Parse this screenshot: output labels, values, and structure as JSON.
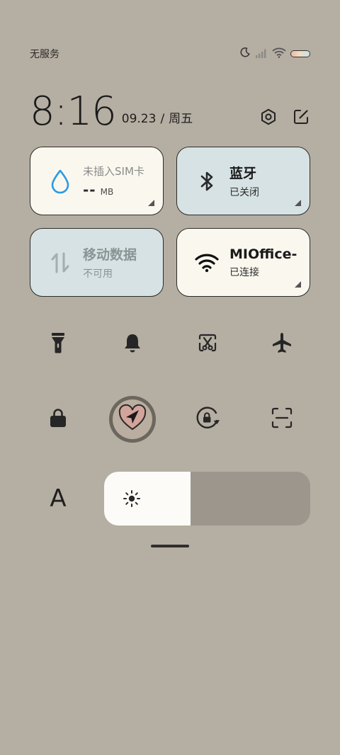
{
  "status": {
    "carrier": "无服务",
    "icons": [
      "moon-icon",
      "signal-icon",
      "wifi-icon",
      "battery-icon"
    ]
  },
  "clock": {
    "time": "8:16",
    "date": "09.23",
    "separator": "/",
    "weekday": "周五",
    "actions": [
      "settings-icon",
      "edit-icon"
    ]
  },
  "tiles": {
    "data_usage": {
      "title": "未插入SIM卡",
      "value": "--",
      "unit": "MB",
      "icon": "water-drop-icon"
    },
    "bluetooth": {
      "title": "蓝牙",
      "sub": "已关闭",
      "icon": "bluetooth-icon"
    },
    "mobile_data": {
      "title": "移动数据",
      "sub": "不可用",
      "icon": "data-arrows-icon"
    },
    "wifi": {
      "title": "MIOffice-",
      "sub": "已连接",
      "icon": "wifi-icon"
    }
  },
  "toggles": {
    "row1": [
      "flashlight-icon",
      "bell-icon",
      "screenshot-icon",
      "airplane-icon"
    ],
    "row2": [
      "lock-icon",
      "location-icon",
      "rotation-lock-icon",
      "scanner-icon"
    ]
  },
  "brightness": {
    "font_label": "A",
    "level": 0.42,
    "icon": "sun-icon"
  },
  "colors": {
    "background": "#b5aea2",
    "tile_cream": "#faf8ee",
    "tile_blue": "#d6e2e3",
    "accent_blue": "#2b9ae6"
  }
}
